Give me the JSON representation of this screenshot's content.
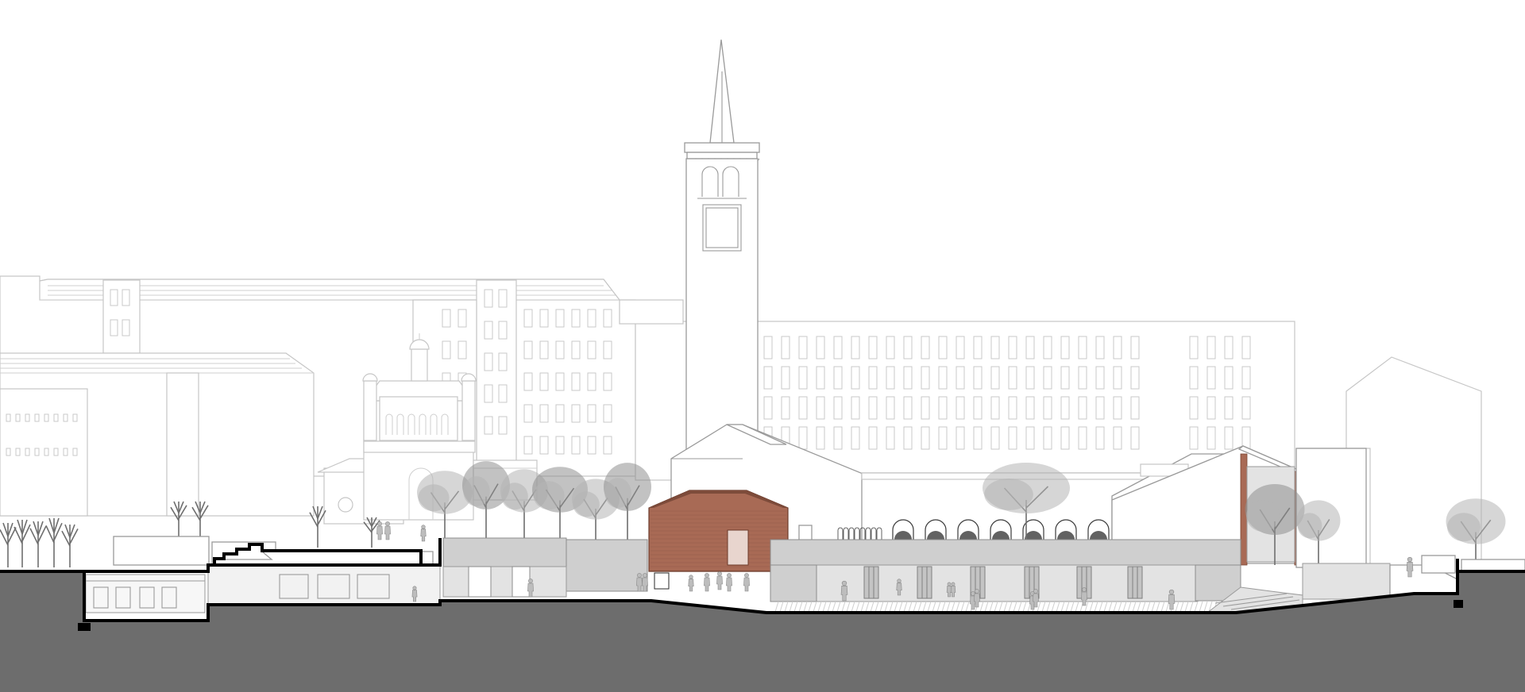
{
  "drawing": {
    "kind": "architectural site section",
    "colors": {
      "background": "#ffffff",
      "ground_fill": "#6d6d6d",
      "section_cut": "#000000",
      "brick": "#a86a55",
      "concrete": "#cfcfcf",
      "context_lines": "#c6c6c6"
    },
    "elements": [
      "bell-tower",
      "background-apartment-block",
      "left-background-buildings",
      "domed-church",
      "cloister-building",
      "brick-pavilion",
      "right-pavilion-with-brick-frame",
      "right-gabled-building",
      "underground-gallery",
      "sunken-plaza",
      "stepped-terrace",
      "trees",
      "people"
    ]
  }
}
